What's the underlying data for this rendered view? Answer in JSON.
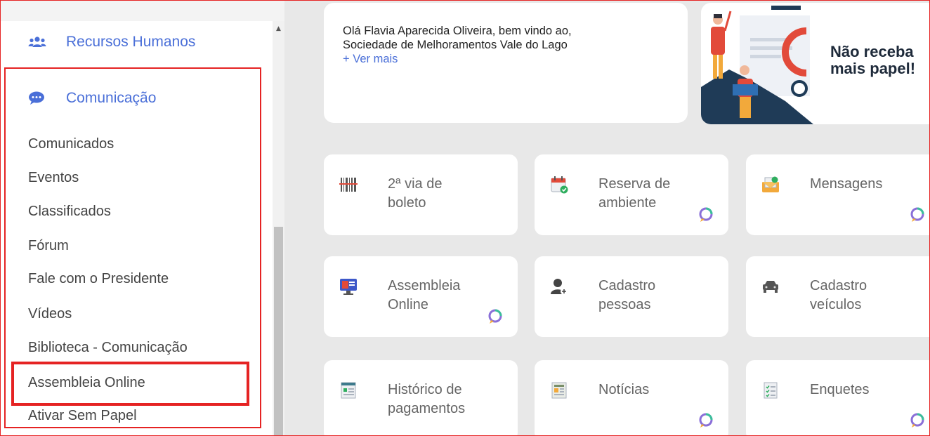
{
  "sidebar": {
    "sections": [
      {
        "label": "Recursos Humanos",
        "icon": "users-icon"
      },
      {
        "label": "Comunicação",
        "icon": "chat-bubble-icon"
      }
    ],
    "items": [
      {
        "label": "Comunicados"
      },
      {
        "label": "Eventos"
      },
      {
        "label": "Classificados"
      },
      {
        "label": "Fórum"
      },
      {
        "label": "Fale com o Presidente"
      },
      {
        "label": "Vídeos"
      },
      {
        "label": "Biblioteca - Comunicação"
      },
      {
        "label": "Assembleia Online"
      },
      {
        "label": "Ativar Sem Papel"
      }
    ]
  },
  "welcome": {
    "line1": "Olá Flavia Aparecida Oliveira, bem vindo ao,",
    "line2": "Sociedade de Melhoramentos Vale do Lago",
    "more": "+ Ver mais"
  },
  "banner": {
    "line1": "Não receba",
    "line2": "mais papel!"
  },
  "tiles": [
    {
      "line1": "2ª via de",
      "line2": "boleto",
      "icon": "barcode-icon",
      "chat": false
    },
    {
      "line1": "Reserva de",
      "line2": "ambiente",
      "icon": "calendar-check-icon",
      "chat": true
    },
    {
      "line1": "Mensagens",
      "line2": "",
      "icon": "envelope-icon",
      "chat": true
    },
    {
      "line1": "Assembleia",
      "line2": "Online",
      "icon": "monitor-icon",
      "chat": true
    },
    {
      "line1": "Cadastro",
      "line2": "pessoas",
      "icon": "add-person-icon",
      "chat": false
    },
    {
      "line1": "Cadastro",
      "line2": "veículos",
      "icon": "car-icon",
      "chat": false
    },
    {
      "line1": "Histórico de",
      "line2": "pagamentos",
      "icon": "receipt-icon",
      "chat": false
    },
    {
      "line1": "Notícias",
      "line2": "",
      "icon": "newspaper-icon",
      "chat": true
    },
    {
      "line1": "Enquetes",
      "line2": "",
      "icon": "checklist-icon",
      "chat": true
    }
  ],
  "colors": {
    "accent": "#4a6fd8",
    "highlight": "#e52323",
    "main_bg": "#e8e8e8"
  }
}
